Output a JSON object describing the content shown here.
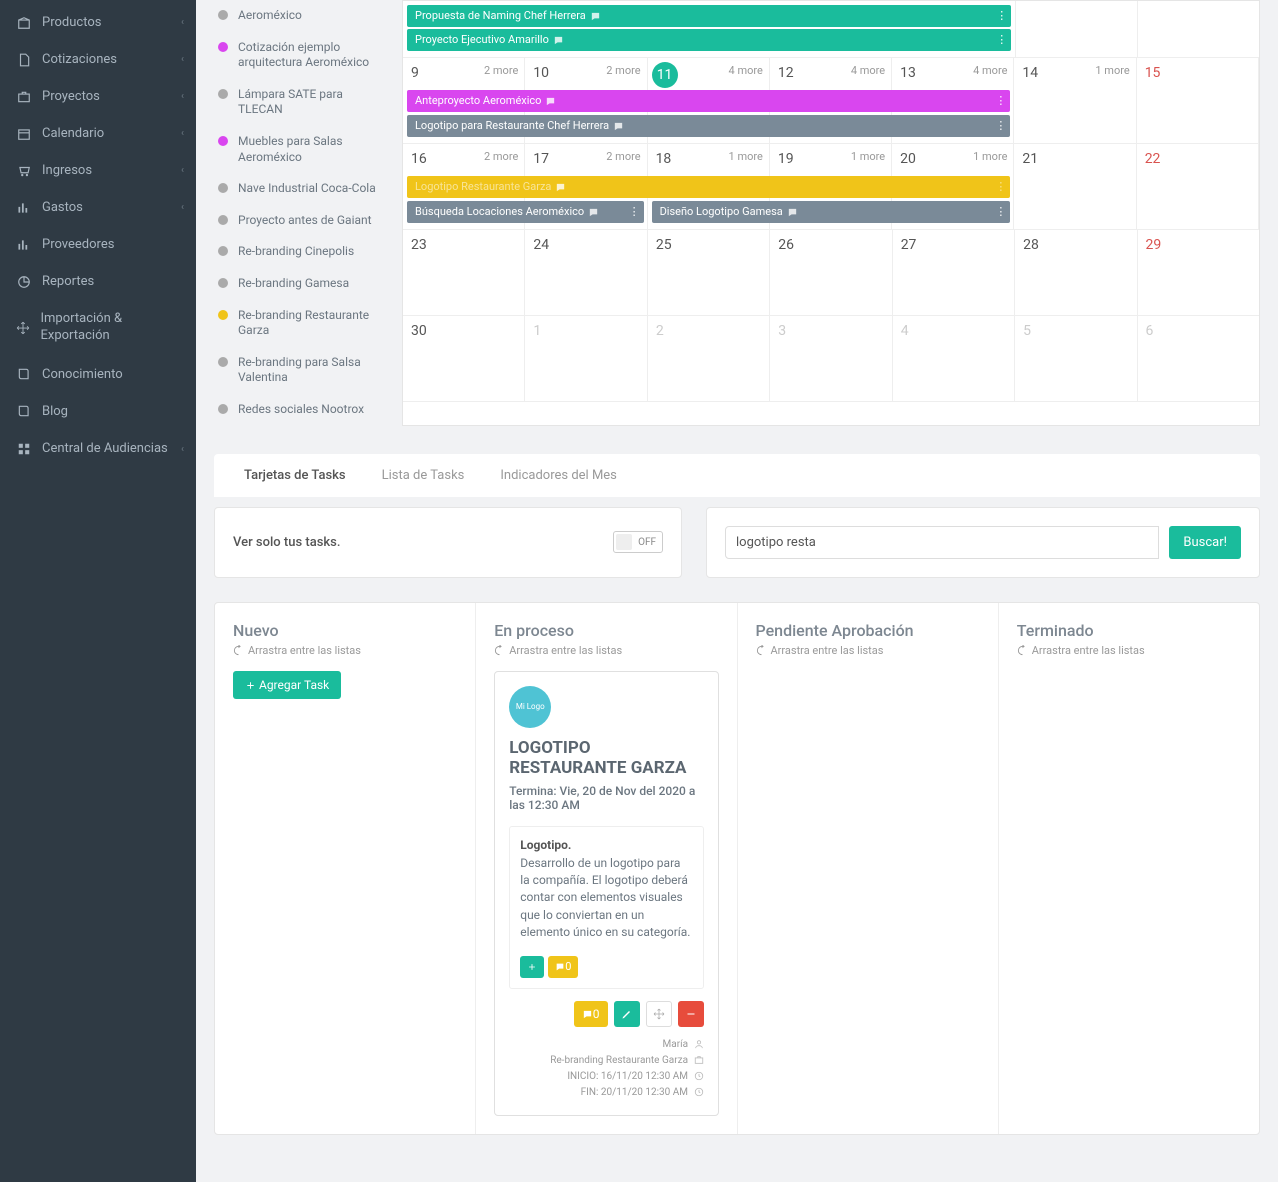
{
  "nav": [
    {
      "icon": "box",
      "label": "Productos",
      "chev": true
    },
    {
      "icon": "file",
      "label": "Cotizaciones",
      "chev": true
    },
    {
      "icon": "briefcase",
      "label": "Proyectos",
      "chev": true
    },
    {
      "icon": "calendar",
      "label": "Calendario",
      "chev": true
    },
    {
      "icon": "cart",
      "label": "Ingresos",
      "chev": true
    },
    {
      "icon": "bars",
      "label": "Gastos",
      "chev": true
    },
    {
      "icon": "chart",
      "label": "Proveedores"
    },
    {
      "icon": "pie",
      "label": "Reportes"
    },
    {
      "icon": "move",
      "label": "Importación & Exportación"
    },
    {
      "icon": "book",
      "label": "Conocimiento"
    },
    {
      "icon": "book",
      "label": "Blog"
    },
    {
      "icon": "grid",
      "label": "Central de Audiencias",
      "chev": true
    }
  ],
  "projects": [
    {
      "c": "#aaa",
      "t": "Aeroméxico"
    },
    {
      "c": "#d946ef",
      "t": "Cotización ejemplo arquitectura Aeroméxico"
    },
    {
      "c": "#aaa",
      "t": "Lámpara SATE para TLECAN"
    },
    {
      "c": "#d946ef",
      "t": "Muebles para Salas Aeroméxico"
    },
    {
      "c": "#aaa",
      "t": "Nave Industrial Coca-Cola"
    },
    {
      "c": "#aaa",
      "t": "Proyecto antes de Gaiant"
    },
    {
      "c": "#aaa",
      "t": "Re-branding Cinepolis"
    },
    {
      "c": "#aaa",
      "t": "Re-branding Gamesa"
    },
    {
      "c": "#f0c419",
      "t": "Re-branding Restaurante Garza"
    },
    {
      "c": "#aaa",
      "t": "Re-branding para Salsa Valentina"
    },
    {
      "c": "#aaa",
      "t": "Redes sociales Nootrox"
    }
  ],
  "cal": {
    "row0_bars": [
      {
        "text": "Propuesta de Naming Chef Herrera",
        "bg": "#1abc9c"
      },
      {
        "text": "Proyecto Ejecutivo Amarillo",
        "bg": "#1abc9c"
      }
    ],
    "row1": {
      "dates": [
        "9",
        "10",
        "11",
        "12",
        "13",
        "14",
        "15"
      ],
      "more": [
        "2 more",
        "2 more",
        "4 more",
        "4 more",
        "4 more",
        "1 more",
        ""
      ],
      "today": 2,
      "weekend": 6,
      "bars": [
        {
          "text": "Anteproyecto Aeroméxico",
          "bg": "#d946ef",
          "span": 5
        },
        {
          "text": "Logotipo para Restaurante Chef Herrera",
          "bg": "#7a8a98",
          "span": 5
        }
      ]
    },
    "row2": {
      "dates": [
        "16",
        "17",
        "18",
        "19",
        "20",
        "21",
        "22"
      ],
      "more": [
        "2 more",
        "2 more",
        "1 more",
        "1 more",
        "1 more",
        "",
        ""
      ],
      "weekend": 6,
      "bars": [
        {
          "text": "Logotipo Restaurante Garza",
          "bg": "#f0c419",
          "span": 5,
          "fade": true
        },
        {
          "text": "Búsqueda Locaciones Aeroméxico",
          "bg": "#7a8a98",
          "span": 2
        },
        {
          "text": "Diseño Logotipo Gamesa",
          "bg": "#7a8a98",
          "span": 3,
          "offset": 2,
          "row": 1
        }
      ]
    },
    "row3": {
      "dates": [
        "23",
        "24",
        "25",
        "26",
        "27",
        "28",
        "29"
      ],
      "weekend": 6
    },
    "row4": {
      "dates": [
        "30",
        "1",
        "2",
        "3",
        "4",
        "5",
        "6"
      ],
      "faded": [
        1,
        2,
        3,
        4,
        5,
        6
      ]
    }
  },
  "tabs": [
    "Tarjetas de Tasks",
    "Lista de Tasks",
    "Indicadores del Mes"
  ],
  "toolbar": {
    "own_label": "Ver solo tus tasks.",
    "toggle": "OFF",
    "search_value": "logotipo resta",
    "search_btn": "Buscar!"
  },
  "board": {
    "cols": [
      "Nuevo",
      "En proceso",
      "Pendiente Aprobación",
      "Terminado"
    ],
    "hint": "Arrastra entre las listas",
    "add": "Agregar Task"
  },
  "card": {
    "logo": "Mi Logo",
    "title": "LOGOTIPO RESTAURANTE GARZA",
    "sub": "Termina: Vie, 20 de Nov del 2020 a las 12:30 AM",
    "body_h": "Logotipo.",
    "body_t": "Desarrollo de un logotipo para la compañía. El logotipo deberá contar con elementos visuales que lo conviertan en un elemento único en su categoría.",
    "chip1": "+",
    "chip2": "0",
    "act_comment": "0",
    "meta": {
      "user": "María",
      "proj": "Re-branding Restaurante Garza",
      "start": "INICIO: 16/11/20 12:30 AM",
      "end": "FIN: 20/11/20 12:30 AM"
    }
  }
}
